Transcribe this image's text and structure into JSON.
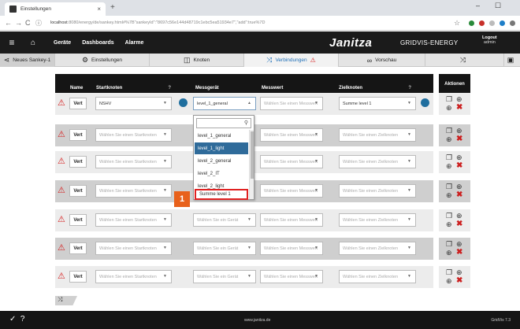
{
  "browser": {
    "tab_title": "Einstellungen",
    "url_host": "localhost",
    "url_rest": ":8080/energy/de/sankey.html#%7B\"sankeyId\":\"8697c56e144d48719c1ebc5ea51934e7\",\"add\":true%7D"
  },
  "header": {
    "nav": [
      "Geräte",
      "Dashboards",
      "Alarme"
    ],
    "brand": "Janitza",
    "brand_suffix": "GRIDVIS-ENERGY",
    "logout": "Logout",
    "user": "admin"
  },
  "subbar": {
    "sankey": "Neues Sankey-1",
    "settings": "Einstellungen",
    "nodes": "Knoten",
    "connections": "Verbindungen",
    "preview": "Vorschau"
  },
  "table": {
    "headers": {
      "name": "Name",
      "start": "Startknoten",
      "device": "Messgerät",
      "value": "Messwert",
      "target": "Zielknoten"
    },
    "actions_header": "Aktionen",
    "vert_label": "Vert",
    "ph_start": "Wählen Sie einen Startknoten",
    "ph_value": "Wählen Sie einen Messwert",
    "ph_target": "Wählen Sie einen Zielknoten",
    "ph_device": "Wählen Sie ein Gerät",
    "row1": {
      "start": "NSHV",
      "device": "level_1_general",
      "target": "Summe level 1"
    }
  },
  "dropdown": {
    "search_value": "",
    "options": [
      "level_1_general",
      "level_1_light",
      "level_2_general",
      "level_2_IT",
      "level_2_light",
      "Summe level 1"
    ],
    "highlighted": "level_1_light",
    "marked": "Summe level 1"
  },
  "annotation": {
    "step": "1"
  },
  "footer": {
    "center": "www.janitza.de",
    "version": "GridVis 7.3"
  },
  "colors": {
    "warning": "#d62020",
    "header_bg": "#151515",
    "highlight": "#2f6b9a",
    "badge": "#e8611b"
  }
}
